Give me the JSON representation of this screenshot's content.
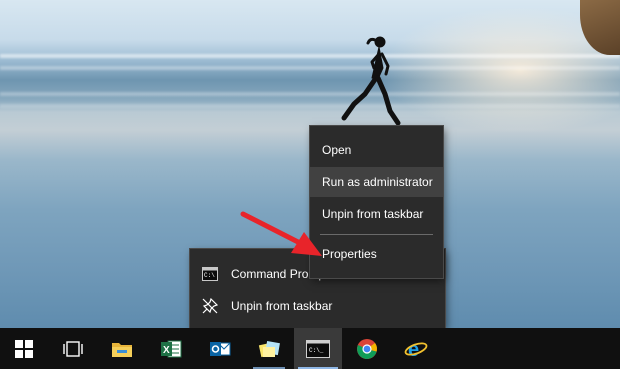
{
  "context_menu": {
    "items": [
      {
        "label": "Open"
      },
      {
        "label": "Run as administrator"
      },
      {
        "label": "Unpin from taskbar"
      },
      {
        "label": "Properties"
      }
    ]
  },
  "jump_list": {
    "items": [
      {
        "label": "Command Prompt",
        "icon": "command-prompt-icon"
      },
      {
        "label": "Unpin from taskbar",
        "icon": "unpin-icon"
      }
    ]
  },
  "taskbar": {
    "buttons": [
      {
        "icon": "windows-start-icon"
      },
      {
        "icon": "task-view-icon"
      },
      {
        "icon": "file-explorer-icon"
      },
      {
        "icon": "excel-icon"
      },
      {
        "icon": "outlook-icon"
      },
      {
        "icon": "sticky-notes-icon"
      },
      {
        "icon": "command-prompt-icon"
      },
      {
        "icon": "chrome-icon"
      },
      {
        "icon": "internet-explorer-icon"
      }
    ]
  },
  "colors": {
    "menu_bg": "#2b2b2b",
    "menu_highlight": "#414141",
    "taskbar_bg": "#101010",
    "arrow": "#e8242a"
  }
}
